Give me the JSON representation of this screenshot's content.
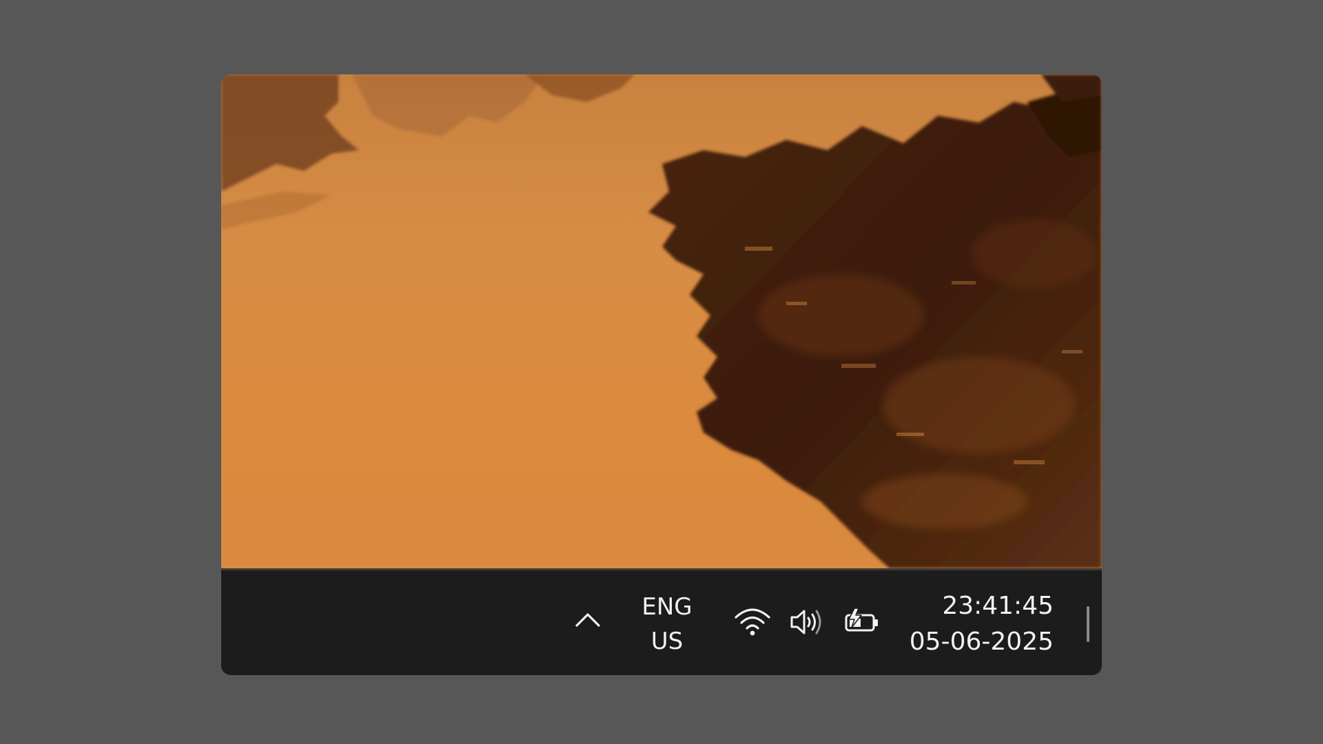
{
  "taskbar": {
    "language": {
      "code": "ENG",
      "region": "US"
    },
    "clock": {
      "time": "23:41:45",
      "date": "05-06-2025"
    },
    "tray_icons": [
      "chevron-up-icon",
      "wifi-icon",
      "volume-icon",
      "battery-charging-icon"
    ]
  },
  "colors": {
    "desktop_background": "#575757",
    "taskbar": "#1c1c1c",
    "wallpaper_orange": "#d9883e",
    "wallpaper_dark": "#3a1d0b"
  }
}
